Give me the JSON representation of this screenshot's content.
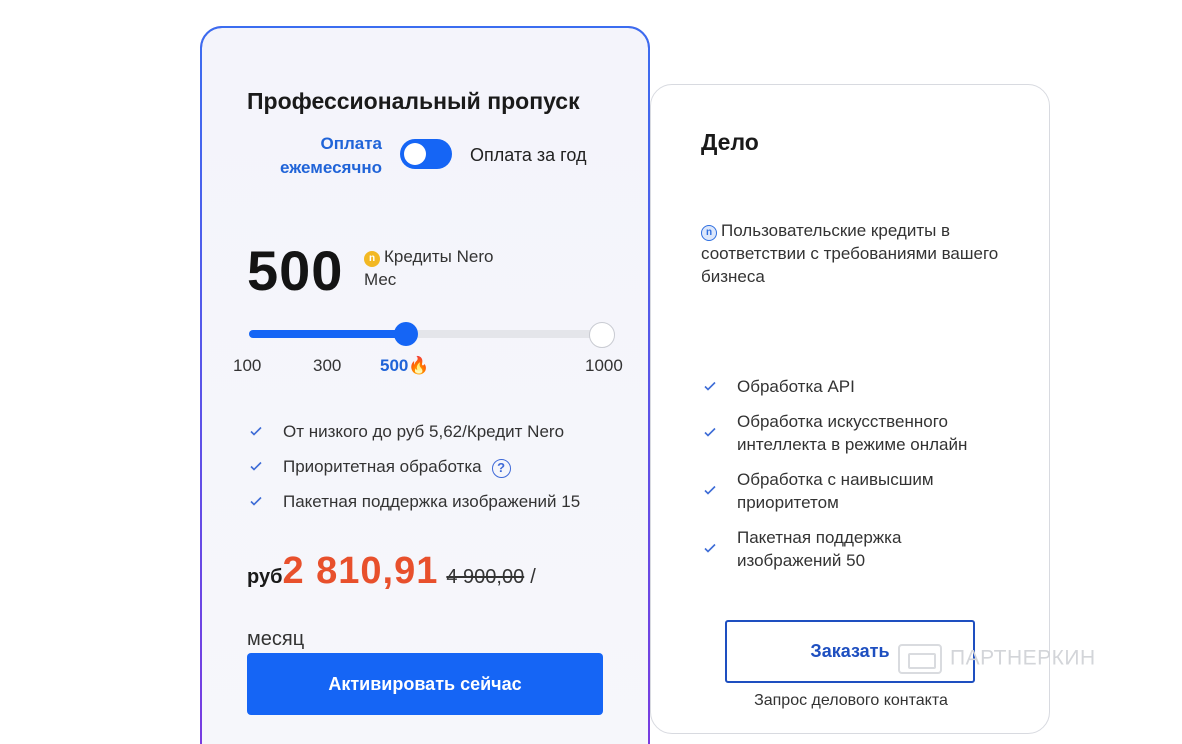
{
  "pro": {
    "title": "Профессиональный пропуск",
    "billing_monthly": "Оплата ежемесячно",
    "billing_yearly": "Оплата за год",
    "billing_monthly_selected": true,
    "credits_amount": "500",
    "credits_label": "Кредиты Nero",
    "credits_period": "Мес",
    "slider": {
      "ticks": [
        "100",
        "300",
        "500",
        "1000"
      ],
      "selected": "500",
      "selected_badge": "🔥",
      "fill_fraction": 0.43
    },
    "features": [
      "От низкого до руб 5,62/Кредит Nero",
      "Приоритетная обработка",
      "Пакетная поддержка изображений 15"
    ],
    "currency": "руб",
    "price": "2 810,91",
    "old_price": "4 900,00",
    "slash": "/",
    "per_month": "месяц",
    "cta": "Активировать сейчас"
  },
  "business": {
    "title": "Дело",
    "description": "Пользовательские кредиты в соответствии с требованиями вашего бизнеса",
    "features": [
      "Обработка API",
      "Обработка искусственного интеллекта в режиме онлайн",
      "Обработка с наивысшим приоритетом",
      "Пакетная поддержка изображений 50"
    ],
    "cta": "Заказать",
    "contact": "Запрос делового контакта"
  },
  "watermark": "ПАРТНЕРКИН",
  "colors": {
    "accent": "#1565f5",
    "price": "#e8502c",
    "link": "#2064d8"
  }
}
